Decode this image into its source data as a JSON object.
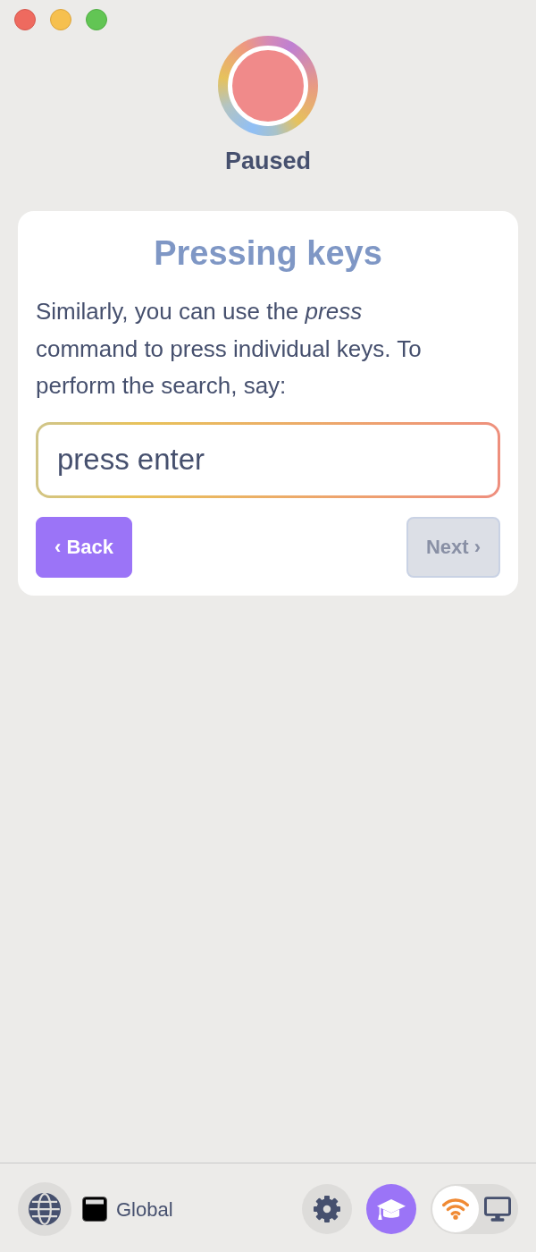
{
  "record": {
    "label": "Paused"
  },
  "card": {
    "title": "Pressing keys",
    "text": "Similarly, you can use the *press* command to press individual keys. To perform the search, say:",
    "command": "press enter",
    "buttons": [
      {
        "label": "‹ Back",
        "disabled": false
      },
      {
        "label": "Next ›",
        "disabled": true
      }
    ]
  },
  "footer": {
    "scope": "Global",
    "buttons": [
      {
        "kind": "settings",
        "selected": false
      },
      {
        "kind": "tutorial",
        "selected": true
      }
    ],
    "mode_toggle": [
      {
        "kind": "wifi",
        "selected": true
      },
      {
        "kind": "screen",
        "selected": false
      }
    ]
  }
}
